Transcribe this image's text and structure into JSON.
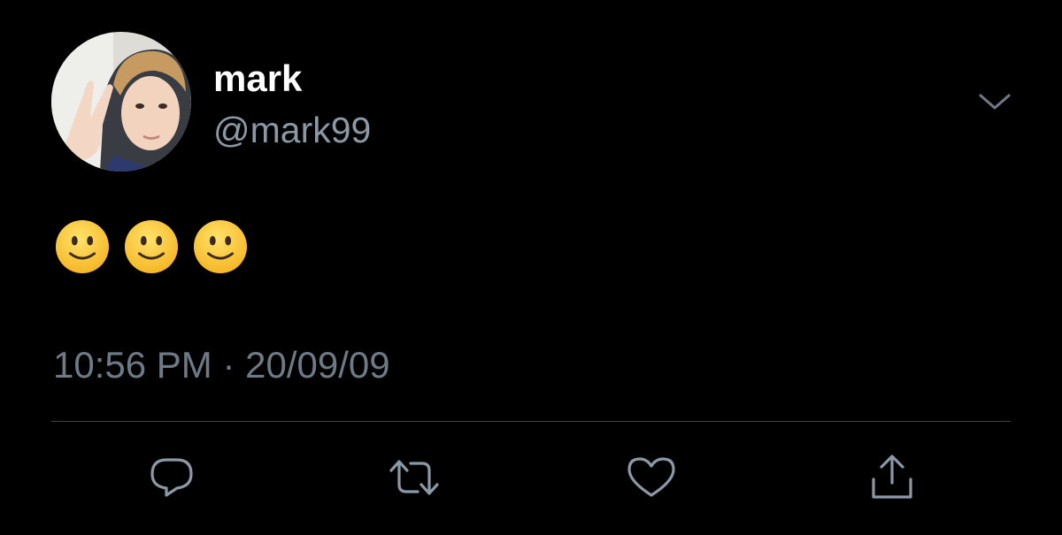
{
  "user": {
    "display_name": "mark",
    "handle": "@mark99"
  },
  "tweet": {
    "emojis": [
      "slightly-smiling-face",
      "slightly-smiling-face",
      "slightly-smiling-face"
    ],
    "timestamp": "10:56 PM · 20/09/09"
  },
  "actions": [
    "reply-icon",
    "retweet-icon",
    "like-icon",
    "share-icon"
  ],
  "colors": {
    "background": "#000000",
    "name": "#ffffff",
    "secondary_text": "#8b98a5",
    "icon": "#8b98a5",
    "divider": "#38444d",
    "emoji_yellow": "#ffc83d"
  }
}
